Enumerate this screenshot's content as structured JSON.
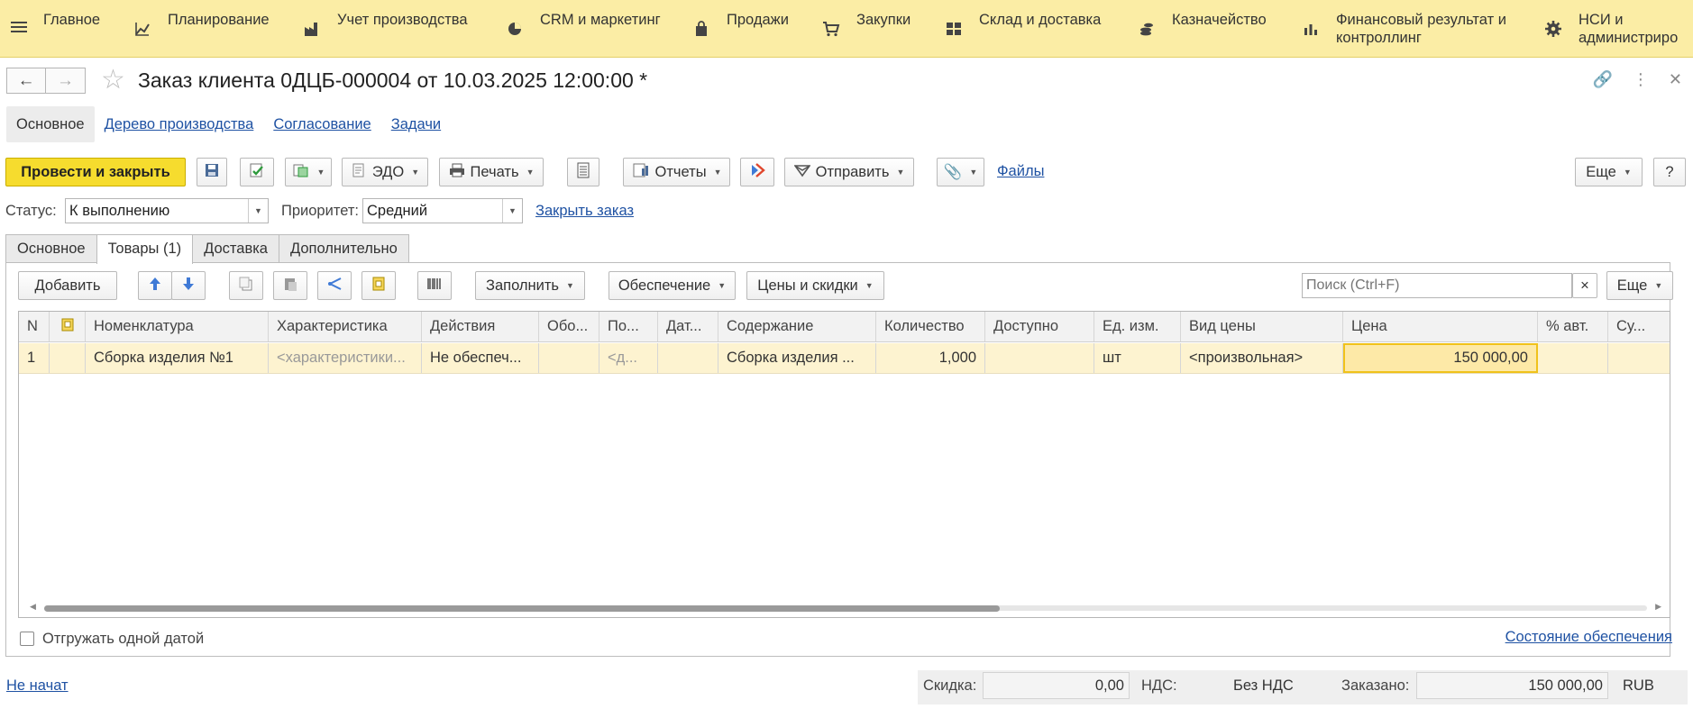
{
  "sections": [
    {
      "label": "Главное",
      "icon": "none"
    },
    {
      "label": "Планирование",
      "icon": "planning-icon"
    },
    {
      "label": "Учет производства",
      "icon": "factory-icon"
    },
    {
      "label": "CRM и маркетинг",
      "icon": "pie-chart-icon"
    },
    {
      "label": "Продажи",
      "icon": "shopping-bag-icon"
    },
    {
      "label": "Закупки",
      "icon": "cart-icon"
    },
    {
      "label": "Склад и доставка",
      "icon": "warehouse-icon"
    },
    {
      "label": "Казначейство",
      "icon": "coins-icon"
    },
    {
      "label": "Финансовый результат и",
      "label2": "контроллинг",
      "icon": "bar-chart-icon"
    },
    {
      "label": "НСИ и",
      "label2": "администриро",
      "icon": "gear-icon"
    }
  ],
  "window": {
    "title": "Заказ клиента 0ДЦБ-000004 от 10.03.2025 12:00:00 *"
  },
  "form_tabs": [
    "Основное",
    "Дерево производства",
    "Согласование",
    "Задачи"
  ],
  "toolbar": {
    "post_close": "Провести и закрыть",
    "edo": "ЭДО",
    "print": "Печать",
    "reports": "Отчеты",
    "send": "Отправить",
    "files": "Файлы",
    "more": "Еще",
    "help": "?"
  },
  "status": {
    "status_label": "Статус:",
    "status_value": "К выполнению",
    "priority_label": "Приоритет:",
    "priority_value": "Средний",
    "close_order": "Закрыть заказ"
  },
  "page_tabs": [
    "Основное",
    "Товары (1)",
    "Доставка",
    "Дополнительно"
  ],
  "goods_bar": {
    "add": "Добавить",
    "fill": "Заполнить",
    "provision": "Обеспечение",
    "prices": "Цены и скидки",
    "search_placeholder": "Поиск (Ctrl+F)",
    "clear": "×",
    "more": "Еще"
  },
  "table": {
    "headers": [
      "N",
      "",
      "Номенклатура",
      "Характеристика",
      "Действия",
      "Обо...",
      "По...",
      "Дат...",
      "Содержание",
      "Количество",
      "Доступно",
      "Ед. изм.",
      "Вид цены",
      "Цена",
      "% авт.",
      "Су..."
    ],
    "rows": [
      [
        "1",
        "",
        "Сборка изделия №1",
        "<характеристики...",
        "Не обеспеч...",
        "",
        "<д...",
        "",
        "Сборка изделия ...",
        "1,000",
        "",
        "шт",
        "<произвольная>",
        "150 000,00",
        "",
        ""
      ]
    ]
  },
  "bottom": {
    "ship_one_date": "Отгружать одной датой",
    "provision_state": "Состояние обеспечения",
    "state_link": "Не начат"
  },
  "footer": {
    "discount_label": "Скидка:",
    "discount_value": "0,00",
    "vat_label": "НДС:",
    "vat_value": "Без НДС",
    "ordered_label": "Заказано:",
    "ordered_value": "150 000,00",
    "currency": "RUB"
  },
  "colors": {
    "topbar": "#fbeda5",
    "primary_button": "#f6dc2e",
    "link": "#1f52a3",
    "row_highlight": "#fdf3d0"
  }
}
